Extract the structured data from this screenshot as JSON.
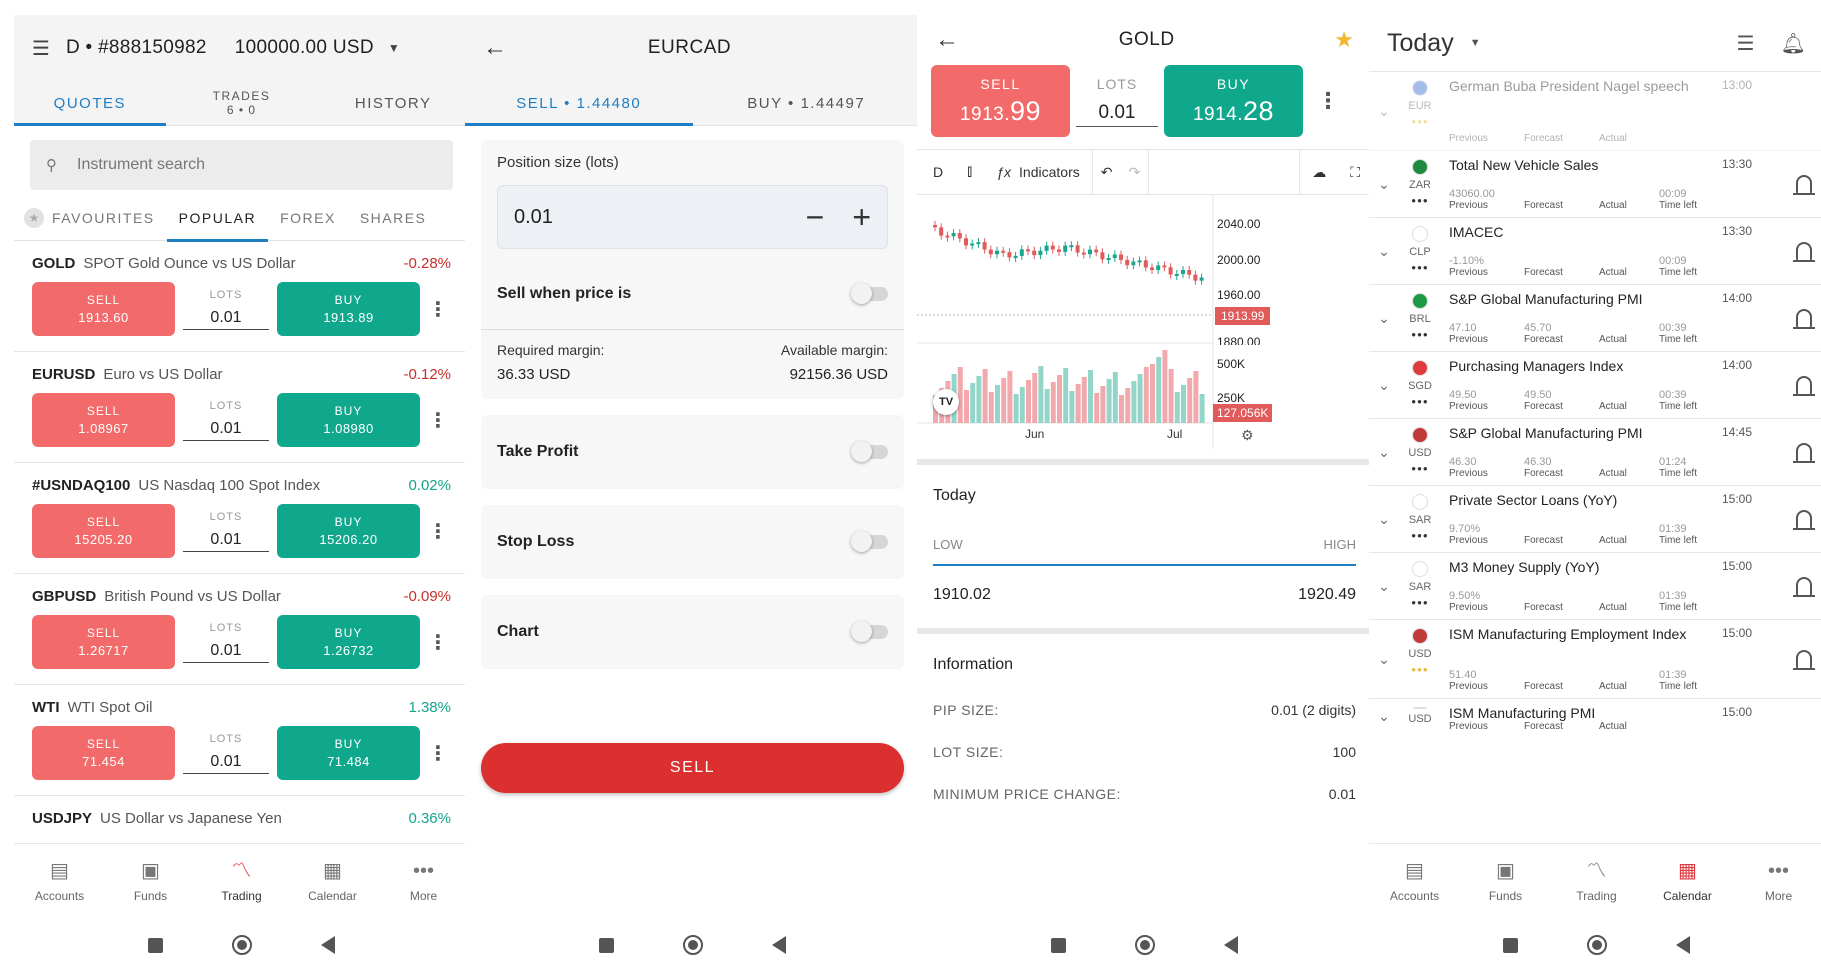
{
  "s1": {
    "account": "D • #888150982",
    "balance": "100000.00 USD",
    "tabs": [
      {
        "label": "QUOTES",
        "sub": ""
      },
      {
        "label": "TRADES",
        "sub": "6 • 0"
      },
      {
        "label": "HISTORY",
        "sub": ""
      }
    ],
    "search_placeholder": "Instrument search",
    "categories": [
      "FAVOURITES",
      "POPULAR",
      "FOREX",
      "SHARES"
    ],
    "lots_label": "LOTS",
    "sell_label": "SELL",
    "buy_label": "BUY",
    "instruments": [
      {
        "symbol": "GOLD",
        "desc": "SPOT Gold Ounce vs US Dollar",
        "change": "-0.28%",
        "sell": "1913.60",
        "buy": "1913.89",
        "lots": "0.01"
      },
      {
        "symbol": "EURUSD",
        "desc": "Euro vs US Dollar",
        "change": "-0.12%",
        "sell": "1.08967",
        "buy": "1.08980",
        "lots": "0.01"
      },
      {
        "symbol": "#USNDAQ100",
        "desc": "US Nasdaq 100 Spot Index",
        "change": "0.02%",
        "sell": "15205.20",
        "buy": "15206.20",
        "lots": "0.01"
      },
      {
        "symbol": "GBPUSD",
        "desc": "British Pound vs US Dollar",
        "change": "-0.09%",
        "sell": "1.26717",
        "buy": "1.26732",
        "lots": "0.01"
      },
      {
        "symbol": "WTI",
        "desc": "WTI Spot Oil",
        "change": "1.38%",
        "sell": "71.454",
        "buy": "71.484",
        "lots": "0.01"
      },
      {
        "symbol": "USDJPY",
        "desc": "US Dollar vs Japanese Yen",
        "change": "0.36%"
      }
    ]
  },
  "nav": {
    "items": [
      "Accounts",
      "Funds",
      "Trading",
      "Calendar",
      "More"
    ]
  },
  "s2": {
    "title": "EURCAD",
    "tabs": [
      "SELL • 1.44480",
      "BUY • 1.44497"
    ],
    "position_label": "Position size (lots)",
    "position_value": "0.01",
    "sell_when": "Sell when price is",
    "req_margin_label": "Required margin:",
    "req_margin_value": "36.33 USD",
    "avail_margin_label": "Available margin:",
    "avail_margin_value": "92156.36 USD",
    "take_profit": "Take Profit",
    "stop_loss": "Stop Loss",
    "chart": "Chart",
    "sell_button": "SELL"
  },
  "s3": {
    "title": "GOLD",
    "sell_label": "SELL",
    "sell_main": "1913.",
    "sell_big": "99",
    "lots_label": "LOTS",
    "lots_value": "0.01",
    "buy_label": "BUY",
    "buy_main": "1914.",
    "buy_big": "28",
    "toolbar_interval": "D",
    "toolbar_indicators": "Indicators",
    "chart_prices": [
      "2040.00",
      "2000.00",
      "1960.00",
      "1880.00"
    ],
    "chart_current": "1913.99",
    "vol_labels": [
      "500K",
      "250K"
    ],
    "vol_current": "127.056K",
    "months": [
      "Jun",
      "Jul"
    ],
    "today": "Today",
    "low_label": "LOW",
    "high_label": "HIGH",
    "low_value": "1910.02",
    "high_value": "1920.49",
    "info_title": "Information",
    "info": [
      {
        "k": "PIP SIZE:",
        "v": "0.01 (2 digits)"
      },
      {
        "k": "LOT SIZE:",
        "v": "100"
      },
      {
        "k": "MINIMUM PRICE CHANGE:",
        "v": "0.01"
      }
    ]
  },
  "s4": {
    "title": "Today",
    "lbl_prev": "Previous",
    "lbl_fore": "Forecast",
    "lbl_act": "Actual",
    "lbl_time": "Time left",
    "events": [
      {
        "cur": "EUR",
        "title": "German Buba President Nagel speech",
        "time": "13:00",
        "prev": "",
        "fore": "",
        "left": "",
        "dots": "y",
        "dim": true,
        "flag": "#3a6fd8"
      },
      {
        "cur": "ZAR",
        "title": "Total New Vehicle Sales",
        "time": "13:30",
        "prev": "43060.00",
        "fore": "",
        "left": "00:09",
        "dots": "n",
        "flag": "#1e8a3c"
      },
      {
        "cur": "CLP",
        "title": "IMACEC",
        "time": "13:30",
        "prev": "-1.10%",
        "fore": "",
        "left": "00:09",
        "dots": "n",
        "flag": "#ffffff"
      },
      {
        "cur": "BRL",
        "title": "S&P Global Manufacturing PMI",
        "time": "14:00",
        "prev": "47.10",
        "fore": "45.70",
        "left": "00:39",
        "dots": "n",
        "flag": "#1e9a46"
      },
      {
        "cur": "SGD",
        "title": "Purchasing Managers Index",
        "time": "14:00",
        "prev": "49.50",
        "fore": "49.50",
        "left": "00:39",
        "dots": "n",
        "flag": "#e03a3a"
      },
      {
        "cur": "USD",
        "title": "S&P Global Manufacturing PMI",
        "time": "14:45",
        "prev": "46.30",
        "fore": "46.30",
        "left": "01:24",
        "dots": "n",
        "flag": "#c23b3b"
      },
      {
        "cur": "SAR",
        "title": "Private Sector Loans (YoY)",
        "time": "15:00",
        "prev": "9.70%",
        "fore": "",
        "left": "01:39",
        "dots": "n",
        "flag": "#ffffff"
      },
      {
        "cur": "SAR",
        "title": "M3 Money Supply (YoY)",
        "time": "15:00",
        "prev": "9.50%",
        "fore": "",
        "left": "01:39",
        "dots": "n",
        "flag": "#ffffff"
      },
      {
        "cur": "USD",
        "title": "ISM Manufacturing Employment Index",
        "time": "15:00",
        "prev": "51.40",
        "fore": "",
        "left": "01:39",
        "dots": "y",
        "flag": "#c23b3b"
      },
      {
        "cur": "USD",
        "title": "ISM Manufacturing PMI",
        "time": "15:00",
        "prev": "",
        "fore": "",
        "left": "",
        "dots": "n",
        "flag": "#c23b3b"
      }
    ]
  }
}
